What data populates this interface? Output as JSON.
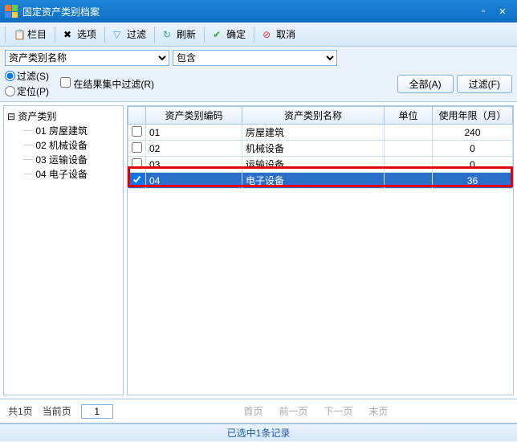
{
  "window": {
    "title": "固定资产类别档案"
  },
  "toolbar": {
    "columns": "栏目",
    "options": "选项",
    "filter": "过滤",
    "refresh": "刷新",
    "ok": "确定",
    "cancel": "取消"
  },
  "filter": {
    "field_options": [
      "资产类别名称"
    ],
    "field_value": "资产类别名称",
    "op_options": [
      "包含"
    ],
    "op_value": "包含",
    "radio_filter": "过滤(S)",
    "radio_locate": "定位(P)",
    "chk_inresult": "在结果集中过滤(R)",
    "btn_all": "全部(A)",
    "btn_filter": "过滤(F)"
  },
  "tree": {
    "root": "资产类别",
    "children": [
      {
        "label": "01 房屋建筑"
      },
      {
        "label": "02 机械设备"
      },
      {
        "label": "03 运输设备"
      },
      {
        "label": "04 电子设备"
      }
    ]
  },
  "grid": {
    "headers": {
      "chk": "",
      "code": "资产类别编码",
      "name": "资产类别名称",
      "unit": "单位",
      "life": "使用年限（月）"
    },
    "rows": [
      {
        "checked": false,
        "code": "01",
        "name": "房屋建筑",
        "unit": "",
        "life": "240",
        "selected": false
      },
      {
        "checked": false,
        "code": "02",
        "name": "机械设备",
        "unit": "",
        "life": "0",
        "selected": false
      },
      {
        "checked": false,
        "code": "03",
        "name": "运输设备",
        "unit": "",
        "life": "0",
        "selected": false
      },
      {
        "checked": true,
        "code": "04",
        "name": "电子设备",
        "unit": "",
        "life": "36",
        "selected": true
      }
    ]
  },
  "pager": {
    "total": "共1页",
    "current_label": "当前页",
    "current_value": "1",
    "first": "首页",
    "prev": "前一页",
    "next": "下一页",
    "last": "末页"
  },
  "status": {
    "text": "已选中1条记录"
  }
}
